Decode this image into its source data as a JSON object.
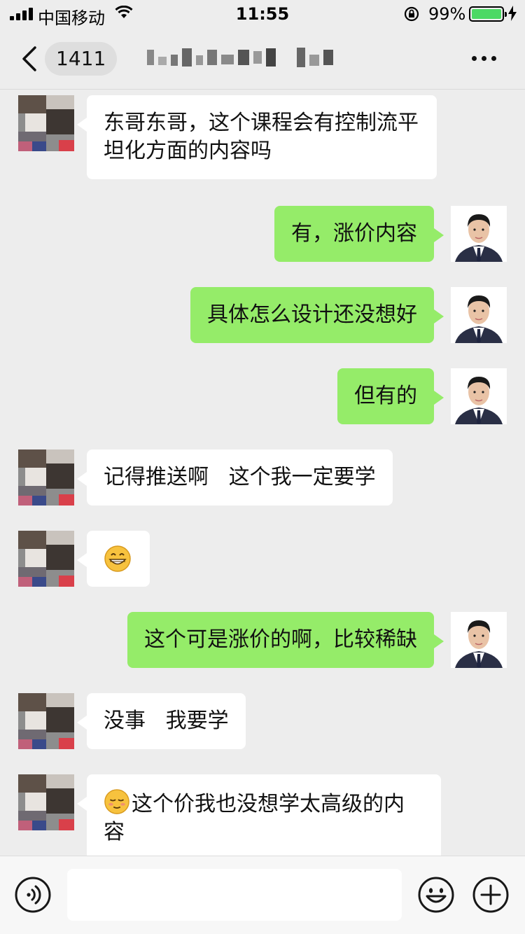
{
  "status_bar": {
    "carrier": "中国移动",
    "time": "11:55",
    "battery_percent_text": "99%",
    "battery_level": 0.99
  },
  "nav": {
    "unread_count": "1411",
    "title": ""
  },
  "colors": {
    "background": "#ededed",
    "sent_bubble": "#95ec69",
    "received_bubble": "#ffffff",
    "battery_fill": "#4cd964"
  },
  "messages": [
    {
      "side": "left",
      "text": "东哥东哥，这个课程会有控制流平坦化方面的内容吗"
    },
    {
      "side": "right",
      "text": "有，涨价内容"
    },
    {
      "side": "right",
      "text": "具体怎么设计还没想好"
    },
    {
      "side": "right",
      "text": "但有的"
    },
    {
      "side": "left",
      "text": "记得推送啊   这个我一定要学"
    },
    {
      "side": "left",
      "text": "",
      "emoji": "grinning-face-emoji"
    },
    {
      "side": "right",
      "text": "这个可是涨价的啊，比较稀缺"
    },
    {
      "side": "left",
      "text": "没事   我要学"
    },
    {
      "side": "left",
      "text": "这个价我也没想学太高级的内容",
      "emoji": "relieved-face-emoji"
    }
  ],
  "input": {
    "value": "",
    "placeholder": ""
  },
  "icons": {
    "back": "chevron-left-icon",
    "more": "more-dots-icon",
    "voice": "voice-icon",
    "emoji": "emoji-icon",
    "plus": "plus-icon"
  }
}
